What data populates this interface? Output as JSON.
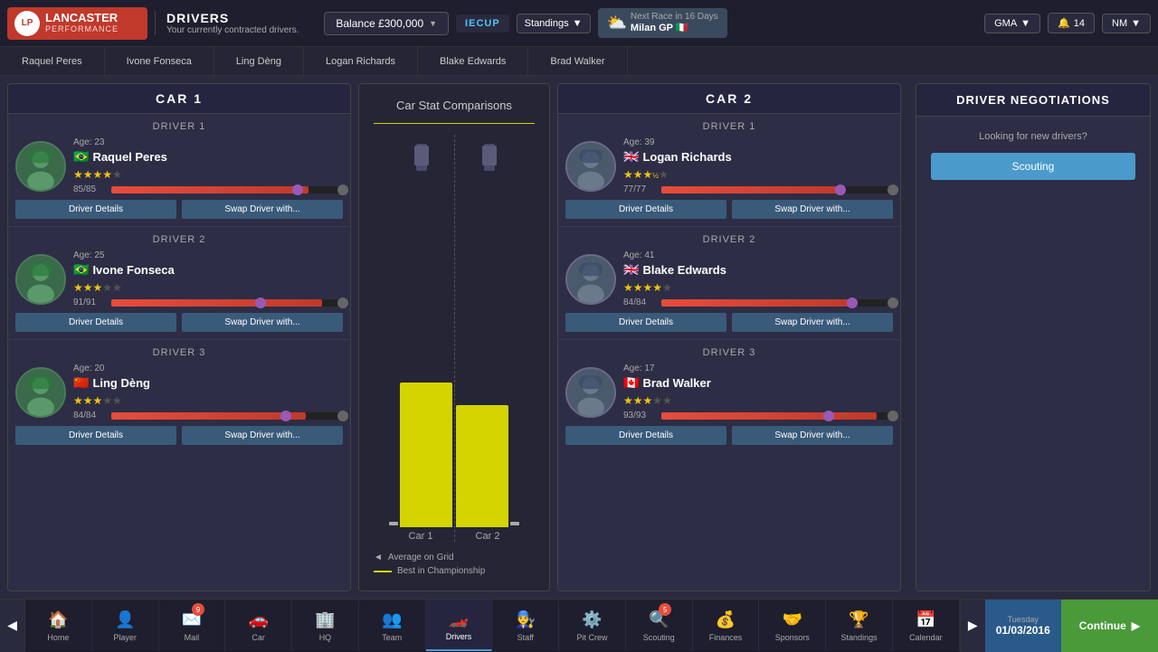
{
  "topbar": {
    "logo": "LP",
    "brand": "LANCASTER",
    "sub": "PERFORMANCE",
    "page_title": "DRIVERS",
    "page_subtitle": "Your currently contracted drivers.",
    "balance": "Balance £300,000",
    "cup": "IECUP",
    "standings": "Standings",
    "race_days": "Next Race in 16 Days",
    "race_name": "Milan GP",
    "race_flag": "🇮🇹",
    "gma": "GMA",
    "notif_count": "14",
    "nm": "NM"
  },
  "driver_tabs": [
    {
      "label": "Raquel Peres"
    },
    {
      "label": "Ivone Fonseca"
    },
    {
      "label": "Ling Dèng"
    },
    {
      "label": "Logan Richards"
    },
    {
      "label": "Blake Edwards"
    },
    {
      "label": "Brad Walker"
    }
  ],
  "car1": {
    "title": "CAR 1",
    "drivers": [
      {
        "label": "DRIVER 1",
        "age": "Age:  23",
        "flag": "🇧🇷",
        "name": "Raquel Peres",
        "stars": 4,
        "stars_total": 5,
        "stat": "85/85",
        "bar_pct": 85,
        "thumb_pct": 82
      },
      {
        "label": "DRIVER 2",
        "age": "Age:  25",
        "flag": "🇧🇷",
        "name": "Ivone Fonseca",
        "stars": 3,
        "stars_total": 5,
        "stat": "91/91",
        "bar_pct": 91,
        "thumb_pct": 65
      },
      {
        "label": "DRIVER 3",
        "age": "Age:  20",
        "flag": "🇨🇳",
        "name": "Ling Dèng",
        "stars": 3,
        "stars_total": 5,
        "stat": "84/84",
        "bar_pct": 84,
        "thumb_pct": 76
      }
    ]
  },
  "car2": {
    "title": "CAR 2",
    "drivers": [
      {
        "label": "DRIVER 1",
        "age": "Age:  39",
        "flag": "🇬🇧",
        "name": "Logan Richards",
        "stars": 3.5,
        "stars_total": 5,
        "stat": "77/77",
        "bar_pct": 77,
        "thumb_pct": 80
      },
      {
        "label": "DRIVER 2",
        "age": "Age:  41",
        "flag": "🇬🇧",
        "name": "Blake Edwards",
        "stars": 4,
        "stars_total": 5,
        "stat": "84/84",
        "bar_pct": 84,
        "thumb_pct": 82
      },
      {
        "label": "DRIVER 3",
        "age": "Age:  17",
        "flag": "🇨🇦",
        "name": "Brad Walker",
        "stars": 3,
        "stars_total": 5,
        "stat": "93/93",
        "bar_pct": 93,
        "thumb_pct": 72
      }
    ]
  },
  "center": {
    "title": "Car Stat Comparisons",
    "car1_bar_height": 160,
    "car2_bar_height": 135,
    "car1_label": "Car 1",
    "car2_label": "Car 2",
    "legend_avg": "Average on Grid",
    "legend_best": "Best in Championship"
  },
  "right_panel": {
    "title": "DRIVER NEGOTIATIONS",
    "subtitle": "Looking for new drivers?",
    "scouting_label": "Scouting"
  },
  "bottom_nav": {
    "items": [
      {
        "icon": "🏠",
        "label": "Home",
        "active": false,
        "badge": null
      },
      {
        "icon": "👤",
        "label": "Player",
        "active": false,
        "badge": null
      },
      {
        "icon": "✉️",
        "label": "Mail",
        "active": false,
        "badge": "9"
      },
      {
        "icon": "🚗",
        "label": "Car",
        "active": false,
        "badge": null
      },
      {
        "icon": "🏢",
        "label": "HQ",
        "active": false,
        "badge": null
      },
      {
        "icon": "👥",
        "label": "Team",
        "active": false,
        "badge": null
      },
      {
        "icon": "🏎️",
        "label": "Drivers",
        "active": true,
        "badge": null
      },
      {
        "icon": "👨‍🔧",
        "label": "Staff",
        "active": false,
        "badge": null
      },
      {
        "icon": "⚙️",
        "label": "Pit Crew",
        "active": false,
        "badge": null
      },
      {
        "icon": "🔍",
        "label": "Scouting",
        "active": false,
        "badge": "5"
      },
      {
        "icon": "💰",
        "label": "Finances",
        "active": false,
        "badge": null
      },
      {
        "icon": "🤝",
        "label": "Sponsors",
        "active": false,
        "badge": null
      },
      {
        "icon": "🏆",
        "label": "Standings",
        "active": false,
        "badge": null
      },
      {
        "icon": "📅",
        "label": "Calendar",
        "active": false,
        "badge": null
      }
    ],
    "date_day": "Tuesday",
    "date": "01/03/2016",
    "continue": "Continue"
  }
}
